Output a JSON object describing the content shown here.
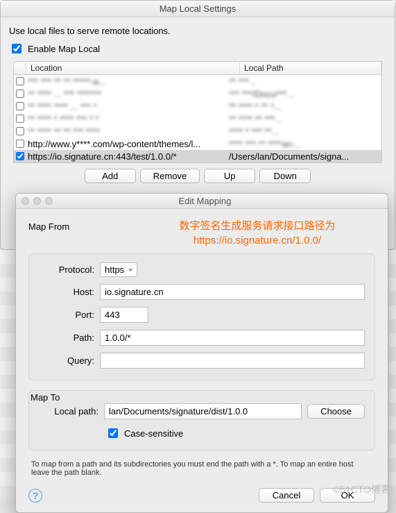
{
  "parent": {
    "title": "Map Local Settings",
    "instruction": "Use local files to serve remote locations.",
    "enable_checked": true,
    "enable_label": "Enable Map Local",
    "columns": {
      "location": "Location",
      "local_path": "Local Path"
    },
    "rows": [
      {
        "checked": false,
        "location_blur": "*** *** ** ** *****-a...",
        "path_blur": "** *** .."
      },
      {
        "checked": false,
        "location_blur": "** **** ... *** *******",
        "path_blur": "*** ***/Docu***..."
      },
      {
        "checked": false,
        "location_blur": "** **** **** ... *** *",
        "path_blur": "** **** * ** *..."
      },
      {
        "checked": false,
        "location_blur": "** **** * **** *** * *",
        "path_blur": "** **** ** ***..."
      },
      {
        "checked": false,
        "location_blur": "** **** ** ** *** ****",
        "path_blur": "**** * *** **..."
      },
      {
        "checked": false,
        "location": "http://www.y****.com/wp-content/themes/l...",
        "path_blur": "**** *** ** ****an..."
      },
      {
        "checked": true,
        "location": "https://io.signature.cn:443/test/1.0.0/*",
        "path": "/Users/lan/Documents/signa..."
      }
    ],
    "buttons": {
      "add": "Add",
      "remove": "Remove",
      "up": "Up",
      "down": "Down"
    }
  },
  "child": {
    "title": "Edit Mapping",
    "annot_line1": "数字签名生成服务请求接口路径为",
    "annot_line2": "https://io.signature.cn/1.0.0/",
    "map_from_title": "Map From",
    "map_to_title": "Map To",
    "labels": {
      "protocol": "Protocol:",
      "host": "Host:",
      "port": "Port:",
      "path": "Path:",
      "query": "Query:",
      "local_path": "Local path:"
    },
    "values": {
      "protocol": "https",
      "host": "io.signature.cn",
      "port": "443",
      "path": "1.0.0/*",
      "query": "",
      "local_path": "lan/Documents/signature/dist/1.0.0"
    },
    "choose_label": "Choose",
    "case_sensitive_checked": true,
    "case_sensitive_label": "Case-sensitive",
    "hint": "To map from a path and its subdirectories you must end the path with a *. To map an entire host leave the path blank.",
    "cancel": "Cancel",
    "ok": "OK"
  },
  "watermark": "©51CTO博客"
}
